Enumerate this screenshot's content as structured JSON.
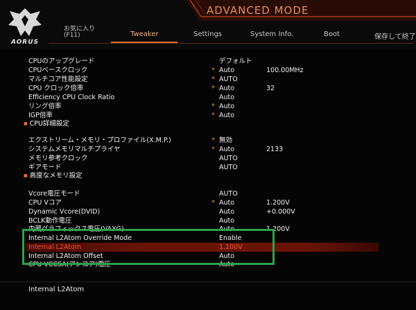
{
  "header": {
    "logo_text": "AORUS",
    "mode_title": "ADVANCED MODE",
    "favorites": {
      "line1": "お気に入り",
      "line2": "(F11)"
    },
    "tabs": [
      {
        "label": "Tweaker",
        "active": true
      },
      {
        "label": "Settings",
        "active": false
      },
      {
        "label": "System Info.",
        "active": false
      },
      {
        "label": "Boot",
        "active": false
      },
      {
        "label": "保存して終了",
        "active": false
      }
    ]
  },
  "settings": [
    {
      "label": "CPUのアップグレード",
      "star": "",
      "value": "デフォルト",
      "extra": ""
    },
    {
      "label": "CPUベースクロック",
      "star": "*",
      "value": "Auto",
      "extra": "100.00MHz"
    },
    {
      "label": "マルチコア性能設定",
      "star": "*",
      "value": "AUTO",
      "extra": ""
    },
    {
      "label": "CPU クロック倍率",
      "star": "*",
      "value": "Auto",
      "extra": "32"
    },
    {
      "label": "Efficiency CPU Clock Ratio",
      "star": "",
      "value": "Auto",
      "extra": ""
    },
    {
      "label": "リング倍率",
      "star": "*",
      "value": "Auto",
      "extra": ""
    },
    {
      "label": "IGP倍率",
      "star": "*",
      "value": "Auto",
      "extra": ""
    },
    {
      "label": "CPU詳細設定",
      "star": "",
      "value": "",
      "extra": ""
    },
    {
      "label": "エクストリーム・メモリ・プロファイル(X.M.P.)",
      "star": "*",
      "value": "無効",
      "extra": ""
    },
    {
      "label": "システムメモリマルチプライヤ",
      "star": "*",
      "value": "Auto",
      "extra": "2133"
    },
    {
      "label": "メモリ参考クロック",
      "star": "",
      "value": "AUTO",
      "extra": ""
    },
    {
      "label": "ギアモード",
      "star": "",
      "value": "AUTO",
      "extra": ""
    },
    {
      "label": "高度なメモリ設定",
      "star": "",
      "value": "",
      "extra": ""
    },
    {
      "label": "Vcore電圧モード",
      "star": "",
      "value": "AUTO",
      "extra": ""
    },
    {
      "label": "CPU Vコア",
      "star": "*",
      "value": "Auto",
      "extra": "1.200V"
    },
    {
      "label": "Dynamic Vcore(DVID)",
      "star": "",
      "value": "Auto",
      "extra": "+0.000V"
    },
    {
      "label": "BCLK動作電圧",
      "star": "",
      "value": "Auto",
      "extra": ""
    },
    {
      "label": "内蔵グラフィックス電圧(VAXG)",
      "star": "",
      "value": "Auto",
      "extra": "1.200V"
    },
    {
      "label": "Internal L2Atom Override Mode",
      "star": "",
      "value": "Enable",
      "extra": ""
    },
    {
      "label": "Internal L2Atom",
      "star": "",
      "value": "1.100V",
      "extra": ""
    },
    {
      "label": "Internal L2Atom Offset",
      "star": "",
      "value": "Auto",
      "extra": ""
    },
    {
      "label": "CPU VCCSA(アンコア)電圧",
      "star": "",
      "value": "Auto",
      "extra": ""
    }
  ],
  "help_text": "Internal L2Atom",
  "colors": {
    "accent": "#e07030",
    "selected_text": "#f05a3a",
    "highlight_box": "#2fa24a",
    "star": "#e08a2a"
  }
}
